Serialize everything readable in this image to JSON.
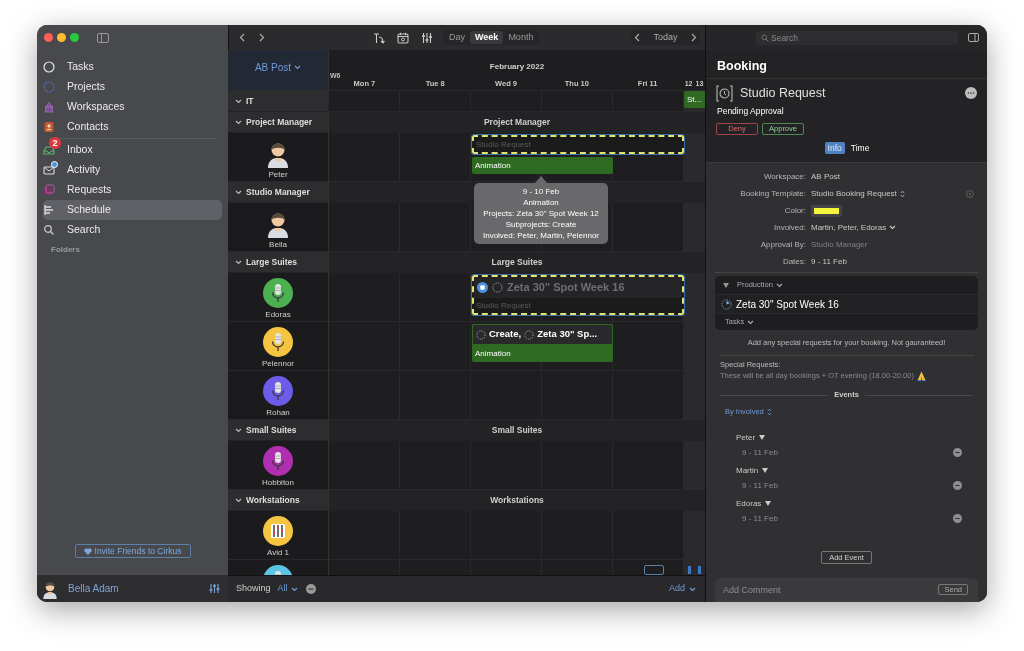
{
  "sidebar": {
    "sections": [
      {
        "items": [
          {
            "label": "Tasks",
            "selected": false,
            "dot": false
          },
          {
            "label": "Projects",
            "selected": false,
            "dot": false
          },
          {
            "label": "Workspaces",
            "selected": false,
            "dot": false
          },
          {
            "label": "Contacts",
            "selected": false,
            "dot": false
          }
        ]
      },
      {
        "items": [
          {
            "label": "Inbox",
            "selected": false,
            "dot": false,
            "badge": "2"
          },
          {
            "label": "Activity",
            "selected": false,
            "dot": true
          },
          {
            "label": "Requests",
            "selected": false,
            "dot": false
          },
          {
            "label": "Schedule",
            "selected": true,
            "dot": false
          },
          {
            "label": "Search",
            "selected": false,
            "dot": false
          }
        ]
      }
    ],
    "section_title": "Folders",
    "invite": "Invite Friends to Cirkus",
    "user": {
      "name": "Bella Adam"
    }
  },
  "toolbar": {
    "views": [
      {
        "label": "Day",
        "selected": false
      },
      {
        "label": "Week",
        "selected": true
      },
      {
        "label": "Month",
        "selected": false
      }
    ],
    "today": "Today"
  },
  "schedule": {
    "workspace": "AB Post",
    "month": "February 2022",
    "week": "W6",
    "days": [
      "Mon 7",
      "Tue 8",
      "Wed 9",
      "Thu 10",
      "Fri 11"
    ],
    "weekend": [
      "12",
      "13"
    ],
    "groups": [
      {
        "name": "IT",
        "expanded": true,
        "events": [
          {
            "kind": "task",
            "title": "St..."
          }
        ]
      },
      {
        "name": "Project Manager",
        "expanded": true,
        "banner": "Project Manager",
        "resources": [
          {
            "name": "Peter",
            "kind": "person",
            "events": [
              {
                "kind": "request",
                "title": "Studio Request"
              },
              {
                "kind": "task",
                "title": "Animation",
                "tooltip": [
                  "9 - 10 Feb",
                  "Animation",
                  "Projects: Zeta 30\" Spot Week 12",
                  "Subprojects: Create",
                  "Involved: Peter, Martin, Pelennor"
                ]
              }
            ]
          }
        ]
      },
      {
        "name": "Studio Manager",
        "expanded": true,
        "resources": [
          {
            "name": "Bella",
            "kind": "person"
          }
        ]
      },
      {
        "name": "Large Suites",
        "expanded": true,
        "banner": "Large Suites",
        "resources": [
          {
            "name": "Edoras",
            "kind": "mic",
            "color": "#4caf50",
            "events": [
              {
                "kind": "request",
                "title": "Studio Request",
                "project": "Zeta 30\" Spot Week 16"
              }
            ]
          },
          {
            "name": "Pelennor",
            "kind": "mic",
            "color": "#f5c542",
            "events": [
              {
                "kind": "task",
                "title": "Animation",
                "header": [
                  "Create,",
                  "Zeta 30\" Sp..."
                ]
              }
            ]
          },
          {
            "name": "Rohan",
            "kind": "mic",
            "color": "#6c5ce7"
          }
        ]
      },
      {
        "name": "Small Suites",
        "expanded": true,
        "banner": "Small Suites",
        "resources": [
          {
            "name": "Hobbiton",
            "kind": "mic",
            "color": "#b02fb0"
          }
        ]
      },
      {
        "name": "Workstations",
        "expanded": true,
        "banner": "Workstations",
        "resources": [
          {
            "name": "Avid 1",
            "kind": "mixer",
            "color": "#f5c542"
          },
          {
            "kind": "mic",
            "color": "#5ec4e6"
          }
        ]
      }
    ]
  },
  "footer": {
    "showing": "Showing",
    "filter": "All",
    "add": "Add"
  },
  "booking": {
    "search_placeholder": "Search",
    "title": "Booking",
    "request": "Studio Request",
    "status": "Pending Approval",
    "actions": [
      {
        "label": "Deny",
        "kind": "deny"
      },
      {
        "label": "Approve",
        "kind": "approve"
      }
    ],
    "tabs": [
      {
        "label": "Info",
        "selected": true
      },
      {
        "label": "Time",
        "selected": false
      }
    ],
    "fields": [
      {
        "label": "Workspace:",
        "value": "AB Post",
        "kind": "text"
      },
      {
        "label": "Booking Template:",
        "value": "Studio Booking Request",
        "kind": "select"
      },
      {
        "label": "Color:",
        "kind": "color",
        "color": "#f5f53c"
      },
      {
        "label": "Involved:",
        "value": "Martin, Peter, Edoras",
        "kind": "menu"
      },
      {
        "label": "Approval By:",
        "value": "Studio Manager",
        "kind": "muted"
      },
      {
        "label": "Dates:",
        "value": "9 - 11 Feb",
        "kind": "text"
      }
    ],
    "production": {
      "label": "Production",
      "project": "Zeta 30\" Spot Week 16",
      "tasks": "Tasks"
    },
    "notice": "Add any special requests for your booking. Not gauranteed!",
    "special_requests": {
      "label": "Special Requests:",
      "value": "These will be all day bookings + OT evening (18.00-20.00)"
    },
    "events_title": "Events",
    "sort": "By Involved",
    "events": [
      {
        "name": "Peter",
        "dates": "9 - 11 Feb"
      },
      {
        "name": "Martin",
        "dates": "9 - 11 Feb"
      },
      {
        "name": "Edoras",
        "dates": "9 - 11 Feb"
      }
    ],
    "add_event": "Add Event",
    "comment_placeholder": "Add Comment",
    "send": "Send"
  }
}
